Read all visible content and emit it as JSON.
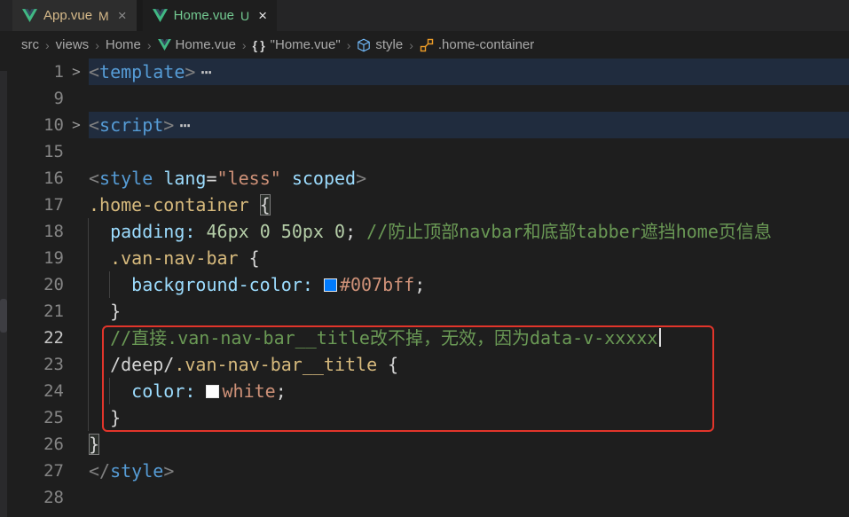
{
  "tabs": [
    {
      "label": "App.vue",
      "git_badge": "M",
      "close": "×",
      "active": false
    },
    {
      "label": "Home.vue",
      "git_badge": "U",
      "close": "×",
      "active": true
    }
  ],
  "breadcrumb": {
    "separator": "›",
    "items": [
      {
        "label": "src"
      },
      {
        "label": "views"
      },
      {
        "label": "Home"
      },
      {
        "icon": "vue-icon",
        "label": "Home.vue"
      },
      {
        "icon": "braces-icon",
        "label": "\"Home.vue\""
      },
      {
        "icon": "cube-icon",
        "label": "style"
      },
      {
        "icon": "class-icon",
        "label": ".home-container"
      }
    ]
  },
  "colors": {
    "background_swatch": "#007bff",
    "title_swatch": "#ffffff",
    "git_modified": "#d7ba8a",
    "git_untracked": "#73c991",
    "annotation_red": "#e2352b"
  },
  "editor": {
    "fold_marker": ">",
    "fold_ellipsis": "⋯",
    "lines": [
      {
        "num": 1,
        "folded": true,
        "tokens": [
          {
            "s": "<",
            "c": "brk"
          },
          {
            "s": "template",
            "c": "tag"
          },
          {
            "s": ">",
            "c": "brk"
          }
        ]
      },
      {
        "num": 9,
        "tokens": []
      },
      {
        "num": 10,
        "folded": true,
        "tokens": [
          {
            "s": "<",
            "c": "brk"
          },
          {
            "s": "script",
            "c": "tag"
          },
          {
            "s": ">",
            "c": "brk"
          }
        ]
      },
      {
        "num": 15,
        "tokens": []
      },
      {
        "num": 16,
        "tokens": [
          {
            "s": "<",
            "c": "brk"
          },
          {
            "s": "style",
            "c": "tag"
          },
          {
            "s": " ",
            "c": "pln"
          },
          {
            "s": "lang",
            "c": "attr"
          },
          {
            "s": "=",
            "c": "pun"
          },
          {
            "s": "\"less\"",
            "c": "str"
          },
          {
            "s": " ",
            "c": "pln"
          },
          {
            "s": "scoped",
            "c": "attr"
          },
          {
            "s": ">",
            "c": "brk"
          }
        ]
      },
      {
        "num": 17,
        "tokens": [
          {
            "s": ".home-container",
            "c": "sel"
          },
          {
            "s": " ",
            "c": "pln"
          },
          {
            "s": "{",
            "c": "pun",
            "box": true
          }
        ]
      },
      {
        "num": 18,
        "tokens": [
          {
            "s": "  ",
            "c": "pln"
          },
          {
            "s": "padding",
            "c": "attr"
          },
          {
            "s": ":",
            "c": "attr"
          },
          {
            "s": " ",
            "c": "pln"
          },
          {
            "s": "46px",
            "c": "num"
          },
          {
            "s": " ",
            "c": "pln"
          },
          {
            "s": "0",
            "c": "num"
          },
          {
            "s": " ",
            "c": "pln"
          },
          {
            "s": "50px",
            "c": "num"
          },
          {
            "s": " ",
            "c": "pln"
          },
          {
            "s": "0",
            "c": "num"
          },
          {
            "s": "; ",
            "c": "pun"
          },
          {
            "s": "//防止顶部navbar和底部tabber遮挡home页信息",
            "c": "com"
          }
        ]
      },
      {
        "num": 19,
        "tokens": [
          {
            "s": "  ",
            "c": "pln"
          },
          {
            "s": ".van-nav-bar",
            "c": "sel"
          },
          {
            "s": " ",
            "c": "pln"
          },
          {
            "s": "{",
            "c": "pun"
          }
        ]
      },
      {
        "num": 20,
        "tokens": [
          {
            "s": "    ",
            "c": "pln"
          },
          {
            "s": "background-color",
            "c": "attr"
          },
          {
            "s": ":",
            "c": "attr"
          },
          {
            "s": " ",
            "c": "pln"
          },
          {
            "k": "swatch",
            "color": "#007bff"
          },
          {
            "s": "#007bff",
            "c": "str"
          },
          {
            "s": ";",
            "c": "pun"
          }
        ]
      },
      {
        "num": 21,
        "tokens": [
          {
            "s": "  ",
            "c": "pln"
          },
          {
            "s": "}",
            "c": "pun"
          }
        ]
      },
      {
        "num": 22,
        "active": true,
        "tokens": [
          {
            "s": "  ",
            "c": "pln"
          },
          {
            "s": "//直接.van-nav-bar__title改不掉，无效，因为data-v-xxxxx",
            "c": "com"
          },
          {
            "k": "cursor"
          }
        ]
      },
      {
        "num": 23,
        "tokens": [
          {
            "s": "  ",
            "c": "pln"
          },
          {
            "s": "/deep/",
            "c": "pun"
          },
          {
            "s": ".van-nav-bar__title",
            "c": "sel"
          },
          {
            "s": " ",
            "c": "pln"
          },
          {
            "s": "{",
            "c": "pun"
          }
        ]
      },
      {
        "num": 24,
        "tokens": [
          {
            "s": "    ",
            "c": "pln"
          },
          {
            "s": "color",
            "c": "attr"
          },
          {
            "s": ":",
            "c": "attr"
          },
          {
            "s": " ",
            "c": "pln"
          },
          {
            "k": "swatch",
            "color": "#ffffff"
          },
          {
            "s": "white",
            "c": "str"
          },
          {
            "s": ";",
            "c": "pun"
          }
        ]
      },
      {
        "num": 25,
        "tokens": [
          {
            "s": "  ",
            "c": "pln"
          },
          {
            "s": "}",
            "c": "pun"
          }
        ]
      },
      {
        "num": 26,
        "tokens": [
          {
            "s": "}",
            "c": "pun",
            "box": true
          }
        ]
      },
      {
        "num": 27,
        "tokens": [
          {
            "s": "</",
            "c": "brk"
          },
          {
            "s": "style",
            "c": "tag"
          },
          {
            "s": ">",
            "c": "brk"
          }
        ]
      },
      {
        "num": 28,
        "tokens": []
      }
    ]
  }
}
